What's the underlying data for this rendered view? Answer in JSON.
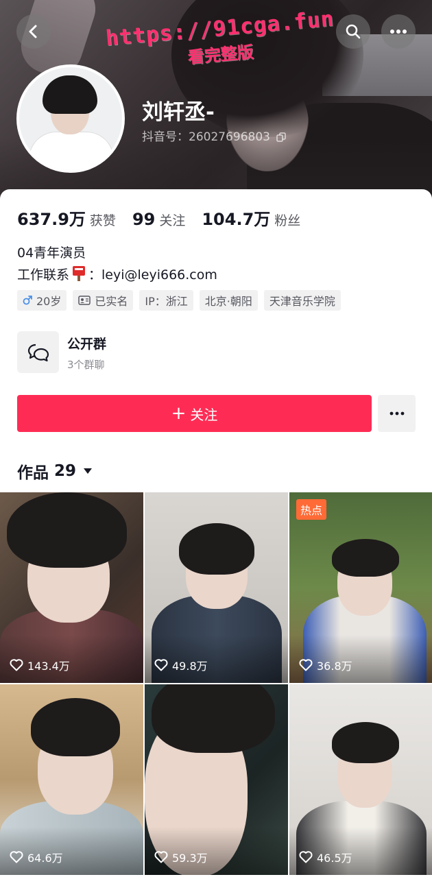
{
  "header": {
    "watermark_url": "https://91cga.fun",
    "watermark_sub": "看完整版",
    "nickname": "刘轩丞-",
    "douyin_id": "抖音号：26027696803"
  },
  "stats": [
    {
      "num": "637.9万",
      "label": "获赞"
    },
    {
      "num": "99",
      "label": "关注"
    },
    {
      "num": "104.7万",
      "label": "粉丝"
    }
  ],
  "bio": {
    "line1": "04青年演员",
    "line2_prefix": "工作联系",
    "line2_suffix": "：leyi@leyi666.com"
  },
  "tags": {
    "age": "20岁",
    "verified": "已实名",
    "ip": "IP：浙江",
    "location": "北京·朝阳",
    "school": "天津音乐学院"
  },
  "group": {
    "title": "公开群",
    "subtitle": "3个群聊"
  },
  "actions": {
    "follow_label": "关注",
    "follow_plus": "+"
  },
  "works": {
    "label": "作品",
    "count": "29"
  },
  "videos": [
    {
      "likes": "143.4万",
      "badge": ""
    },
    {
      "likes": "49.8万",
      "badge": ""
    },
    {
      "likes": "36.8万",
      "badge": "热点"
    },
    {
      "likes": "64.6万",
      "badge": ""
    },
    {
      "likes": "59.3万",
      "badge": ""
    },
    {
      "likes": "46.5万",
      "badge": ""
    }
  ],
  "colors": {
    "accent": "#fe2c55",
    "hot": "#ff6a36",
    "watermark": "#ff2f6f"
  },
  "icons": [
    "back-arrow-icon",
    "search-icon",
    "more-icon",
    "copy-icon",
    "mailbox-icon",
    "male-icon",
    "id-card-icon",
    "group-chat-icon",
    "chevron-down-icon",
    "heart-icon"
  ]
}
